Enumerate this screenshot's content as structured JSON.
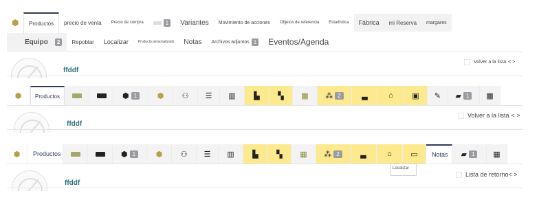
{
  "section1": {
    "row1": [
      {
        "label": "Productos"
      },
      {
        "label": "precio de venta"
      },
      {
        "label": "Precio de compra"
      },
      {
        "label": "Variantes"
      },
      {
        "label": "Movimiento de acciones"
      },
      {
        "label": "Objetos de referencia"
      },
      {
        "label": "Estadística"
      },
      {
        "label": "Fábrica"
      },
      {
        "label": "mi Reserva"
      },
      {
        "label": "margares"
      }
    ],
    "hidden_tab_count": "1",
    "row2": [
      {
        "label": "Equipo",
        "count": "2"
      },
      {
        "label": "Repoblar"
      },
      {
        "label": "Localizar"
      },
      {
        "label": "Producto personalizado"
      },
      {
        "label": "Notas"
      },
      {
        "label": "Archivos adjuntos",
        "count": "1"
      },
      {
        "label": "Eventos/Agenda"
      }
    ],
    "ref": "ffddf",
    "back": "Volver a la lista",
    "nav": "< >"
  },
  "section2": {
    "tab": "Productos",
    "counts": [
      "1",
      "2",
      "1"
    ],
    "ref": "ffddf",
    "back": "Volver a la lista",
    "nav": "< >"
  },
  "section3": {
    "tab": "Productos",
    "notas": "Notas",
    "counts": [
      "1",
      "2",
      "1"
    ],
    "tooltip": "Localizar",
    "ref": "ffddf",
    "back": "Lista de retorno",
    "nav": "< >"
  },
  "colors": {
    "accent_yellow": "#fde98e",
    "tab_border": "#2e3a59",
    "ref_teal": "#2a6f7a"
  }
}
